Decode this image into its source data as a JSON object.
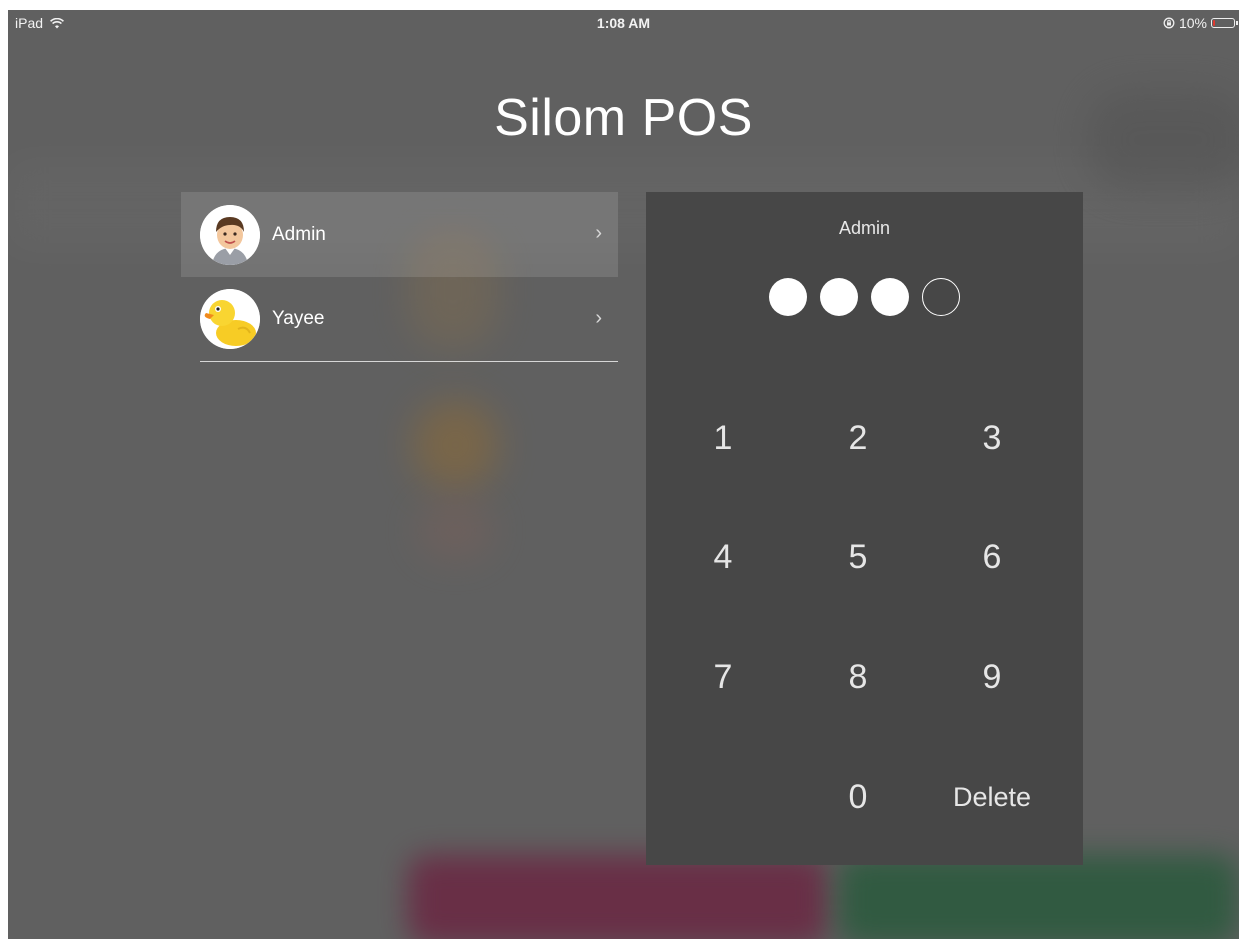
{
  "status_bar": {
    "device": "iPad",
    "wifi_icon": "wifi-icon",
    "time": "1:08 AM",
    "lock_icon": "rotation-lock-icon",
    "battery_percent": "10%",
    "battery_level": 0.1,
    "battery_color": "#e0392f"
  },
  "app": {
    "title": "Silom POS"
  },
  "users": [
    {
      "name": "Admin",
      "avatar": "man-avatar-icon",
      "selected": true
    },
    {
      "name": "Yayee",
      "avatar": "duck-avatar-icon",
      "selected": false
    }
  ],
  "pin_panel": {
    "user": "Admin",
    "entered_digits": 3,
    "total_digits": 4,
    "keys": {
      "k1": "1",
      "k2": "2",
      "k3": "3",
      "k4": "4",
      "k5": "5",
      "k6": "6",
      "k7": "7",
      "k8": "8",
      "k9": "9",
      "k0": "0",
      "delete": "Delete"
    }
  }
}
